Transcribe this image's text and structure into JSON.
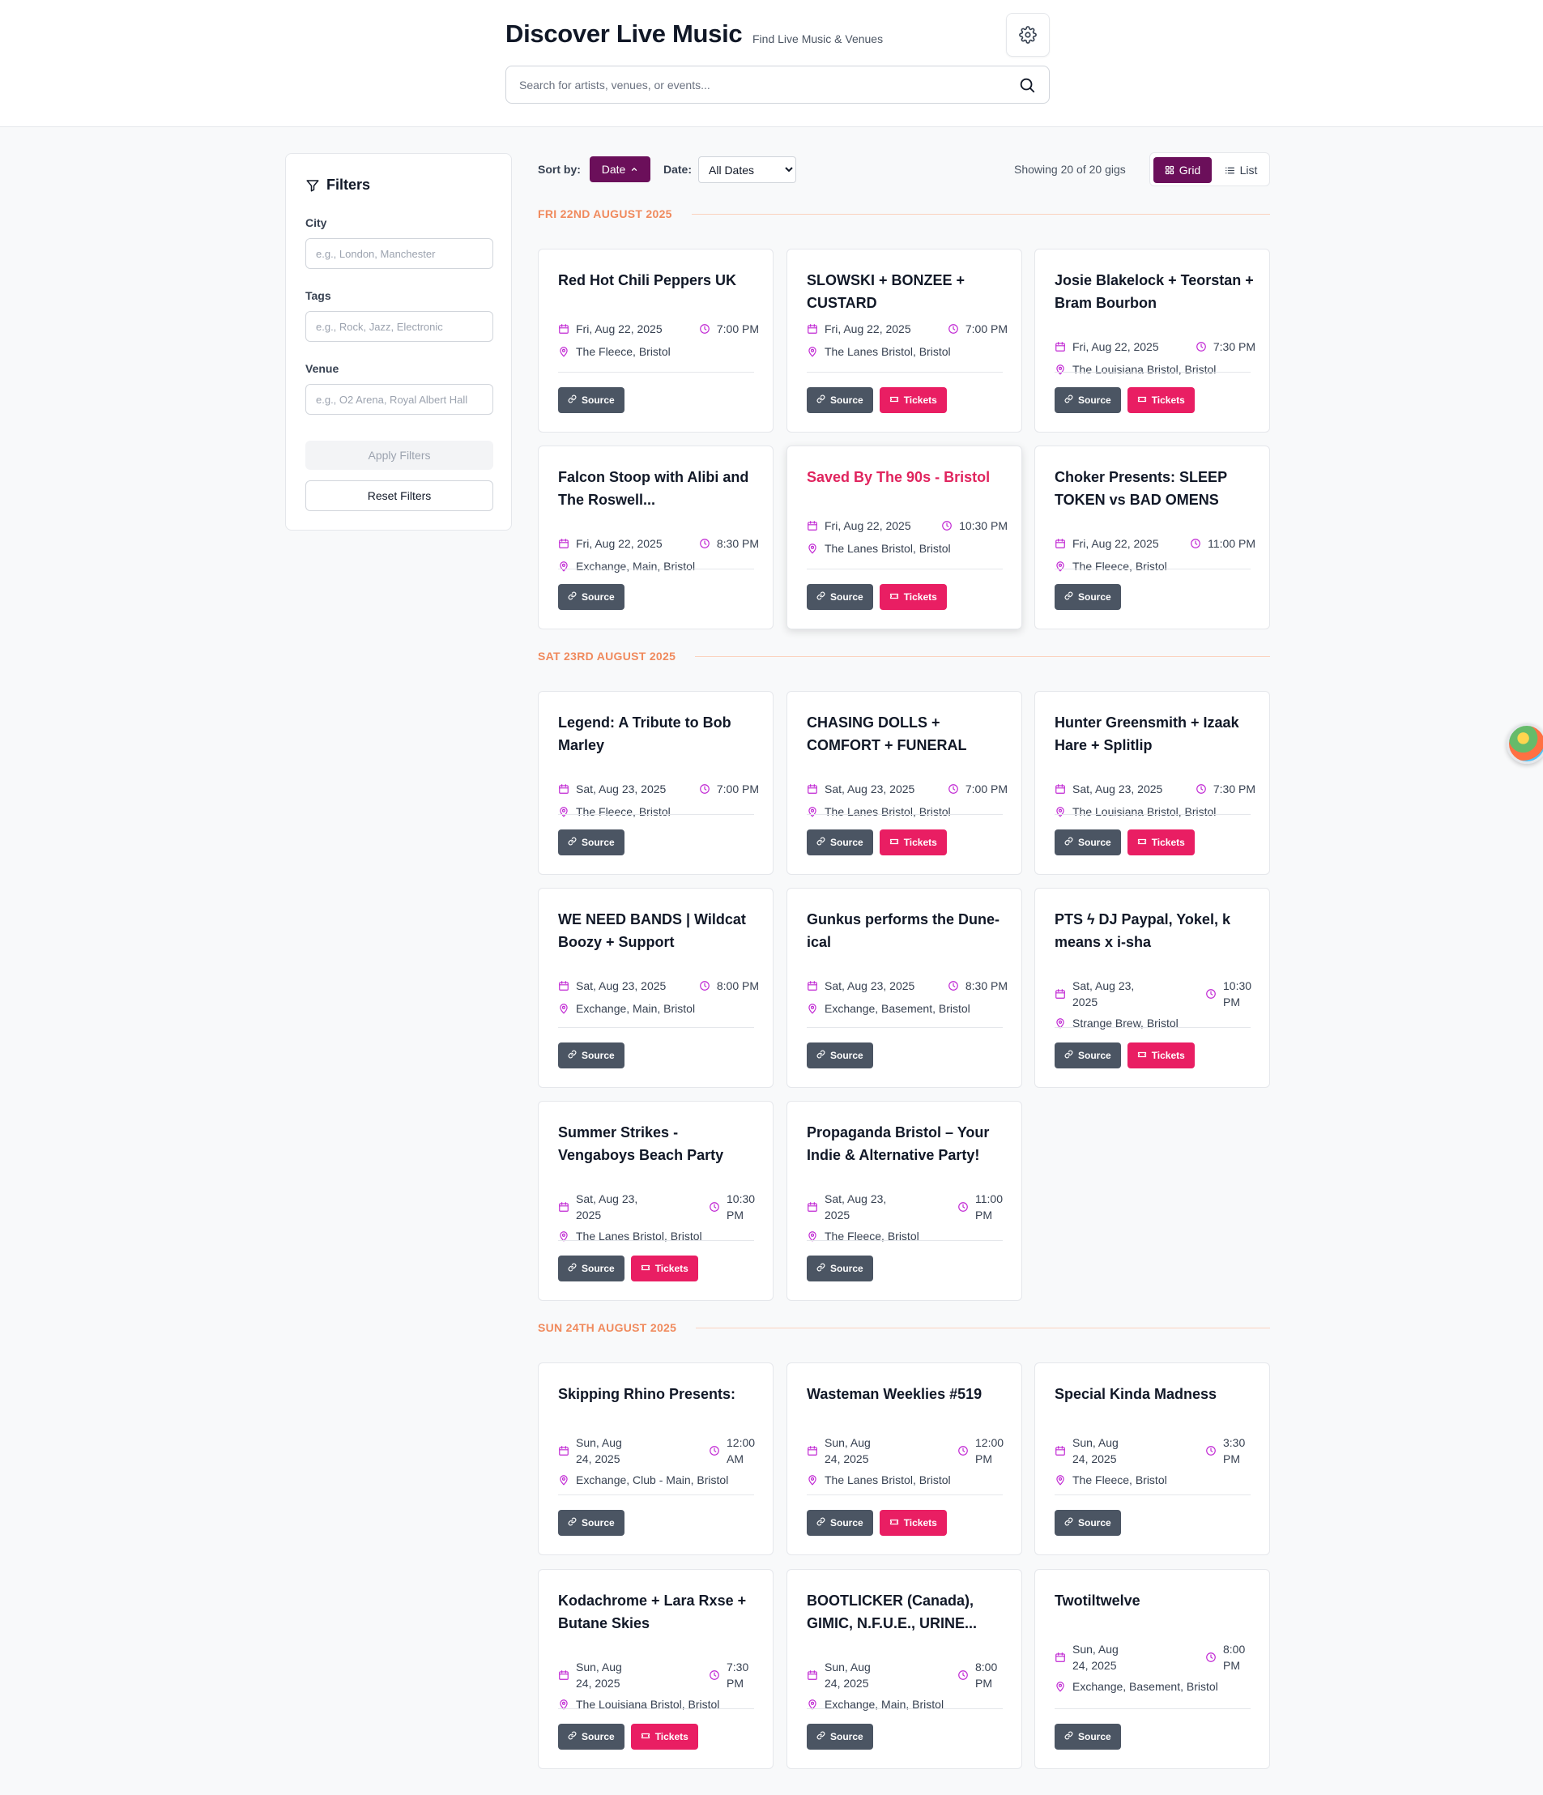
{
  "header": {
    "title": "Discover Live Music",
    "subtitle": "Find Live Music & Venues",
    "search_placeholder": "Search for artists, venues, or events..."
  },
  "filters": {
    "title": "Filters",
    "city_label": "City",
    "city_placeholder": "e.g., London, Manchester",
    "tags_label": "Tags",
    "tags_placeholder": "e.g., Rock, Jazz, Electronic",
    "venue_label": "Venue",
    "venue_placeholder": "e.g., O2 Arena, Royal Albert Hall",
    "apply_label": "Apply Filters",
    "reset_label": "Reset Filters"
  },
  "toolbar": {
    "sort_label": "Sort by:",
    "sort_value": "Date",
    "date_label": "Date:",
    "date_value": "All Dates",
    "showing": "Showing 20 of 20 gigs",
    "grid_label": "Grid",
    "list_label": "List"
  },
  "buttons": {
    "source": "Source",
    "tickets": "Tickets"
  },
  "sections": [
    {
      "heading": "FRI 22ND AUGUST 2025",
      "gigs": [
        {
          "title": "Red Hot Chili Peppers UK",
          "date": "Fri, Aug 22, 2025",
          "time": "7:00 PM",
          "venue": "The Fleece, Bristol",
          "tickets": false
        },
        {
          "title": "SLOWSKI + BONZEE + CUSTARD",
          "date": "Fri, Aug 22, 2025",
          "time": "7:00 PM",
          "venue": "The Lanes Bristol, Bristol",
          "tickets": true
        },
        {
          "title": "Josie Blakelock + Teorstan + Bram Bourbon",
          "date": "Fri, Aug 22, 2025",
          "time": "7:30 PM",
          "venue": "The Louisiana Bristol, Bristol",
          "tickets": true
        },
        {
          "title": "Falcon Stoop with Alibi and The Roswell...",
          "date": "Fri, Aug 22, 2025",
          "time": "8:30 PM",
          "venue": "Exchange, Main, Bristol",
          "tickets": false
        },
        {
          "title": "Saved By The 90s - Bristol",
          "date": "Fri, Aug 22, 2025",
          "time": "10:30 PM",
          "venue": "The Lanes Bristol, Bristol",
          "tickets": true,
          "highlighted": true
        },
        {
          "title": "Choker Presents: SLEEP TOKEN vs BAD OMENS",
          "date": "Fri, Aug 22, 2025",
          "time": "11:00 PM",
          "venue": "The Fleece, Bristol",
          "tickets": false
        }
      ]
    },
    {
      "heading": "SAT 23RD AUGUST 2025",
      "gigs": [
        {
          "title": "Legend: A Tribute to Bob Marley",
          "date": "Sat, Aug 23, 2025",
          "time": "7:00 PM",
          "venue": "The Fleece, Bristol",
          "tickets": false
        },
        {
          "title": "CHASING DOLLS + COMFORT + FUNERAL",
          "date": "Sat, Aug 23, 2025",
          "time": "7:00 PM",
          "venue": "The Lanes Bristol, Bristol",
          "tickets": true
        },
        {
          "title": "Hunter Greensmith + Izaak Hare + Splitlip",
          "date": "Sat, Aug 23, 2025",
          "time": "7:30 PM",
          "venue": "The Louisiana Bristol, Bristol",
          "tickets": true
        },
        {
          "title": "WE NEED BANDS | Wildcat Boozy + Support",
          "date": "Sat, Aug 23, 2025",
          "time": "8:00 PM",
          "venue": "Exchange, Main, Bristol",
          "tickets": false
        },
        {
          "title": "Gunkus performs the Dune-ical",
          "date": "Sat, Aug 23, 2025",
          "time": "8:30 PM",
          "venue": "Exchange, Basement, Bristol",
          "tickets": false
        },
        {
          "title": "PTS ϟ DJ Paypal, Yokel, k means x i-sha",
          "date": "Sat, Aug 23, 2025",
          "time": "10:30 PM",
          "venue": "Strange Brew, Bristol",
          "tickets": true,
          "wrap": true
        },
        {
          "title": "Summer Strikes - Vengaboys Beach Party",
          "date": "Sat, Aug 23, 2025",
          "time": "10:30 PM",
          "venue": "The Lanes Bristol, Bristol",
          "tickets": true,
          "wrap": true
        },
        {
          "title": "Propaganda Bristol – Your Indie & Alternative Party!",
          "date": "Sat, Aug 23, 2025",
          "time": "11:00 PM",
          "venue": "The Fleece, Bristol",
          "tickets": false,
          "wrap": true
        }
      ]
    },
    {
      "heading": "SUN 24TH AUGUST 2025",
      "gigs": [
        {
          "title": "Skipping Rhino Presents:",
          "date": "Sun, Aug 24, 2025",
          "time": "12:00 AM",
          "venue": "Exchange, Club - Main, Bristol",
          "tickets": false,
          "wrap": true
        },
        {
          "title": "Wasteman Weeklies #519",
          "date": "Sun, Aug 24, 2025",
          "time": "12:00 PM",
          "venue": "The Lanes Bristol, Bristol",
          "tickets": true,
          "wrap": true
        },
        {
          "title": "Special Kinda Madness",
          "date": "Sun, Aug 24, 2025",
          "time": "3:30 PM",
          "venue": "The Fleece, Bristol",
          "tickets": false,
          "wrap": true
        },
        {
          "title": "Kodachrome + Lara Rxse + Butane Skies",
          "date": "Sun, Aug 24, 2025",
          "time": "7:30 PM",
          "venue": "The Louisiana Bristol, Bristol",
          "tickets": true,
          "wrap": true
        },
        {
          "title": "BOOTLICKER (Canada), GIMIC, N.F.U.E., URINE...",
          "date": "Sun, Aug 24, 2025",
          "time": "8:00 PM",
          "venue": "Exchange, Main, Bristol",
          "tickets": false,
          "wrap": true
        },
        {
          "title": "Twotiltwelve",
          "date": "Sun, Aug 24, 2025",
          "time": "8:00 PM",
          "venue": "Exchange, Basement, Bristol",
          "tickets": false,
          "wrap": true
        }
      ]
    }
  ],
  "colors": {
    "accent": "#6b0f5a",
    "tickets": "#e91e63",
    "source": "#4b5563",
    "date_heading": "#f08a5d",
    "icon": "#c026d3"
  },
  "icons": {
    "settings": "gear-icon",
    "search": "search-icon",
    "filter": "filter-icon",
    "calendar": "calendar-icon",
    "clock": "clock-icon",
    "location": "map-pin-icon",
    "link": "link-icon",
    "ticket": "ticket-icon"
  }
}
